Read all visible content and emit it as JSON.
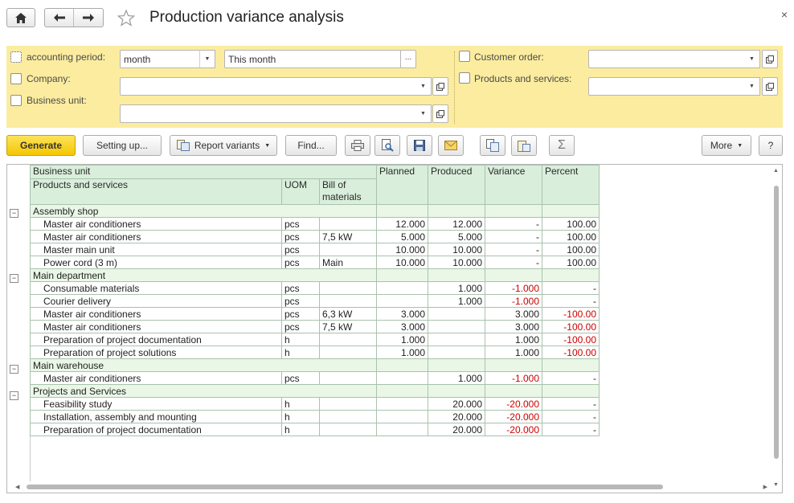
{
  "window": {
    "title": "Production variance analysis",
    "close_glyph": "×"
  },
  "nav": {
    "home_icon": "home-icon",
    "back_icon": "arrow-left-icon",
    "forward_icon": "arrow-right-icon",
    "favorite_icon": "star-icon"
  },
  "filters": {
    "accounting_period": {
      "label": "accounting period:",
      "period_type": "month",
      "period_value": "This month",
      "dots": "..."
    },
    "company": {
      "label": "Company:",
      "value": ""
    },
    "business_unit": {
      "label": "Business unit:",
      "value": ""
    },
    "customer_order": {
      "label": "Customer order:",
      "value": ""
    },
    "products_and_services": {
      "label": "Products and services:",
      "value": ""
    }
  },
  "toolbar": {
    "generate": "Generate",
    "setting_up": "Setting up...",
    "report_variants": "Report variants",
    "find": "Find...",
    "more": "More",
    "help": "?",
    "icons": [
      "print-icon",
      "preview-icon",
      "save-icon",
      "email-icon",
      "copy-icon",
      "paste-icon",
      "sum-icon"
    ]
  },
  "report": {
    "headers": {
      "business_unit": "Business unit",
      "products": "Products and services",
      "uom": "UOM",
      "bom": "Bill of materials",
      "planned": "Planned",
      "produced": "Produced",
      "variance": "Variance",
      "percent": "Percent"
    },
    "groups": [
      {
        "name": "Assembly shop",
        "rows": [
          {
            "product": "Master air conditioners",
            "uom": "pcs",
            "bom": "",
            "planned": "12.000",
            "produced": "12.000",
            "variance": "-",
            "percent": "100.00"
          },
          {
            "product": "Master air conditioners",
            "uom": "pcs",
            "bom": "7,5 kW",
            "planned": "5.000",
            "produced": "5.000",
            "variance": "-",
            "percent": "100.00"
          },
          {
            "product": "Master main unit",
            "uom": "pcs",
            "bom": "",
            "planned": "10.000",
            "produced": "10.000",
            "variance": "-",
            "percent": "100.00"
          },
          {
            "product": "Power cord (3 m)",
            "uom": "pcs",
            "bom": "Main",
            "planned": "10.000",
            "produced": "10.000",
            "variance": "-",
            "percent": "100.00"
          }
        ]
      },
      {
        "name": "Main department",
        "rows": [
          {
            "product": "Consumable materials",
            "uom": "pcs",
            "bom": "",
            "planned": "",
            "produced": "1.000",
            "variance": "-1.000",
            "percent": "-"
          },
          {
            "product": "Courier delivery",
            "uom": "pcs",
            "bom": "",
            "planned": "",
            "produced": "1.000",
            "variance": "-1.000",
            "percent": "-"
          },
          {
            "product": "Master air conditioners",
            "uom": "pcs",
            "bom": "6,3 kW",
            "planned": "3.000",
            "produced": "",
            "variance": "3.000",
            "percent": "-100.00"
          },
          {
            "product": "Master air conditioners",
            "uom": "pcs",
            "bom": "7,5 kW",
            "planned": "3.000",
            "produced": "",
            "variance": "3.000",
            "percent": "-100.00"
          },
          {
            "product": "Preparation of project documentation",
            "uom": "h",
            "bom": "",
            "planned": "1.000",
            "produced": "",
            "variance": "1.000",
            "percent": "-100.00"
          },
          {
            "product": "Preparation of project solutions",
            "uom": "h",
            "bom": "",
            "planned": "1.000",
            "produced": "",
            "variance": "1.000",
            "percent": "-100.00"
          }
        ]
      },
      {
        "name": "Main warehouse",
        "rows": [
          {
            "product": "Master air conditioners",
            "uom": "pcs",
            "bom": "",
            "planned": "",
            "produced": "1.000",
            "variance": "-1.000",
            "percent": "-"
          }
        ]
      },
      {
        "name": "Projects and Services",
        "rows": [
          {
            "product": "Feasibility study",
            "uom": "h",
            "bom": "",
            "planned": "",
            "produced": "20.000",
            "variance": "-20.000",
            "percent": "-"
          },
          {
            "product": "Installation, assembly and mounting",
            "uom": "h",
            "bom": "",
            "planned": "",
            "produced": "20.000",
            "variance": "-20.000",
            "percent": "-"
          },
          {
            "product": "Preparation of project documentation",
            "uom": "h",
            "bom": "",
            "planned": "",
            "produced": "20.000",
            "variance": "-20.000",
            "percent": "-"
          }
        ]
      }
    ],
    "negative_color": "#cc0000",
    "header_color": "#d9eedb",
    "group_color": "#eaf7e7"
  }
}
